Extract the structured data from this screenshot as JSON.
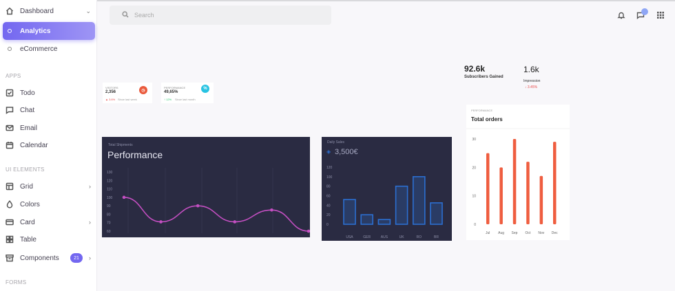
{
  "sidebar": {
    "items": [
      {
        "label": "Dashboard"
      },
      {
        "label": "Analytics"
      },
      {
        "label": "eCommerce"
      },
      {
        "label": "Todo"
      },
      {
        "label": "Chat"
      },
      {
        "label": "Email"
      },
      {
        "label": "Calendar"
      },
      {
        "label": "Grid"
      },
      {
        "label": "Colors"
      },
      {
        "label": "Card"
      },
      {
        "label": "Table"
      },
      {
        "label": "Components"
      }
    ],
    "sections": {
      "apps": "APPS",
      "ui": "UI ELEMENTS",
      "forms": "FORMS"
    },
    "components_badge": "21"
  },
  "topbar": {
    "search_placeholder": "Search"
  },
  "stats": {
    "visitors": {
      "label": "visitors",
      "value": "2,356",
      "change": "▲ 3.6%",
      "period": "Since last week"
    },
    "performance": {
      "label": "performance",
      "value": "49,65%",
      "change": "↑ 12%",
      "period": "Since last month"
    }
  },
  "kpis": {
    "subscribers": {
      "value": "92.6k",
      "label": "Subscribers Gained"
    },
    "impression": {
      "value": "1.6k",
      "label": "Impression",
      "change": "↓ 3.45%"
    }
  },
  "colors": {
    "accent": "#7367f0",
    "line": "#c44fc2",
    "bars_blue": "#2c6fd1",
    "bars_orange": "#ef5d3f"
  },
  "chart_data": [
    {
      "type": "line",
      "subtitle": "Total Shipments",
      "title": "Performance",
      "yticks": [
        130,
        120,
        110,
        100,
        90,
        80,
        70,
        60
      ],
      "values": [
        100,
        71,
        90,
        71,
        85,
        60
      ],
      "ylim": [
        60,
        130
      ]
    },
    {
      "type": "bar",
      "subtitle": "Daily Sales",
      "title": "3,500€",
      "categories": [
        "USA",
        "GER",
        "AUS",
        "UK",
        "RO",
        "BR"
      ],
      "values": [
        52,
        20,
        10,
        80,
        100,
        45
      ],
      "yticks": [
        120,
        100,
        80,
        60,
        40,
        20,
        0
      ],
      "ylim": [
        0,
        120
      ]
    },
    {
      "type": "bar",
      "subtitle": "PERFORMANCE",
      "title": "Total orders",
      "categories": [
        "Jul",
        "Aug",
        "Sep",
        "Oct",
        "Nov",
        "Dec"
      ],
      "values": [
        25,
        20,
        30,
        22,
        17,
        29
      ],
      "yticks": [
        30,
        20,
        10,
        0
      ],
      "ylim": [
        0,
        30
      ]
    }
  ]
}
